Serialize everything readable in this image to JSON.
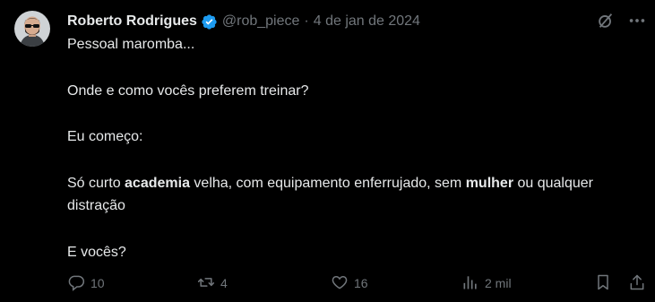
{
  "post": {
    "author_name": "Roberto Rodrigues",
    "handle": "@rob_piece",
    "separator": "·",
    "date": "4 de jan de 2024",
    "text": {
      "line1": "Pessoal maromba...",
      "line2": "Onde e como vocês preferem treinar?",
      "line3": "Eu começo:",
      "line4_part1": "Só curto ",
      "line4_bold1": "academia",
      "line4_part2": " velha, com equipamento enferrujado, sem ",
      "line4_bold2": "mulher",
      "line4_part3": " ou qualquer distração",
      "line5": "E vocês?"
    }
  },
  "actions": {
    "replies": "10",
    "reposts": "4",
    "likes": "16",
    "views": "2 mil"
  },
  "icons": {
    "verified": "verified-badge-icon",
    "grok": "grok-icon",
    "more": "more-icon",
    "reply": "reply-icon",
    "repost": "repost-icon",
    "like": "heart-icon",
    "views": "views-icon",
    "bookmark": "bookmark-icon",
    "share": "share-icon"
  },
  "colors": {
    "background": "#000000",
    "text": "#e7e9ea",
    "secondary": "#71767b",
    "verified": "#1d9bf0"
  }
}
